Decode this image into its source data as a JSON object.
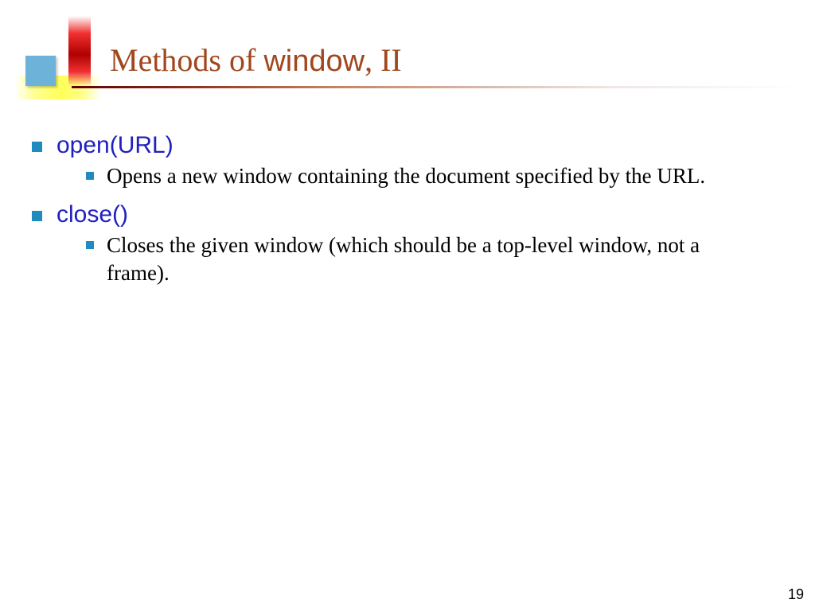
{
  "title": {
    "prefix": "Methods of ",
    "code": "window",
    "suffix": ", II"
  },
  "items": [
    {
      "method": "open(URL)",
      "desc": "Opens a new window containing the document specified by the URL."
    },
    {
      "method": "close()",
      "desc": "Closes the given window (which should be a top-level window, not a frame)."
    }
  ],
  "page_number": "19"
}
